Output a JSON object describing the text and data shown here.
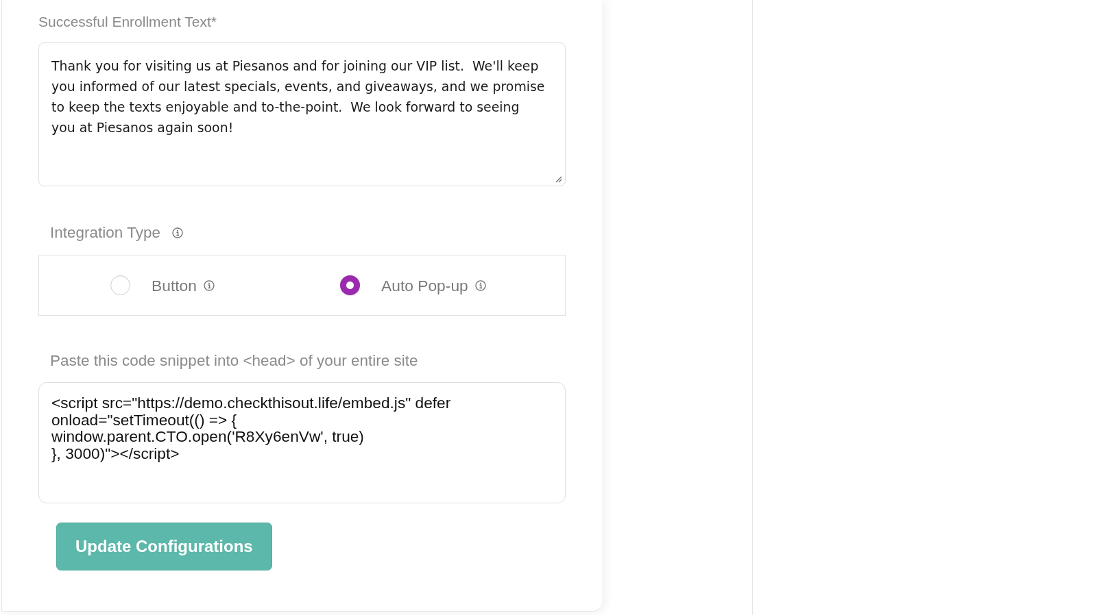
{
  "enrollment_text": {
    "label": "Successful Enrollment Text*",
    "value": "Thank you for visiting us at Piesanos and for joining our VIP list.  We'll keep you informed of our latest specials, events, and giveaways, and we promise to keep the texts enjoyable and to-the-point.  We look forward to seeing you at Piesanos again soon!"
  },
  "integration_type": {
    "label": "Integration Type",
    "options": [
      {
        "label": "Button",
        "selected": false
      },
      {
        "label": "Auto Pop-up",
        "selected": true
      }
    ]
  },
  "code_snippet": {
    "label": "Paste this code snippet into <head> of your entire site",
    "value": "<script src=\"https://demo.checkthisout.life/embed.js\" defer\nonload=\"setTimeout(() => {\nwindow.parent.CTO.open('R8Xy6enVw', true)\n}, 3000)\"></script>"
  },
  "buttons": [
    {
      "label": "Update Configurations"
    }
  ]
}
